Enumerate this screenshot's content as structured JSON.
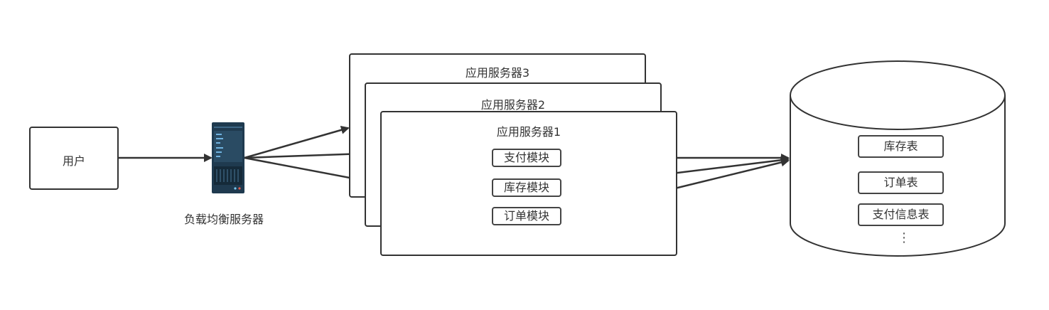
{
  "user": {
    "label": "用户"
  },
  "load_balancer": {
    "label": "负载均衡服务器",
    "icon": "server-rack-icon"
  },
  "app_servers": [
    {
      "title": "应用服务器3"
    },
    {
      "title": "应用服务器2"
    },
    {
      "title": "应用服务器1"
    }
  ],
  "modules": [
    {
      "label": "支付模块"
    },
    {
      "label": "库存模块"
    },
    {
      "label": "订单模块"
    }
  ],
  "database": {
    "icon": "database-cylinder-icon",
    "tables": [
      {
        "label": "库存表"
      },
      {
        "label": "订单表"
      },
      {
        "label": "支付信息表"
      }
    ],
    "more": "⋮"
  },
  "colors": {
    "stroke": "#333333",
    "server_body": "#1f3a4f",
    "server_accent": "#6fb3e0"
  }
}
